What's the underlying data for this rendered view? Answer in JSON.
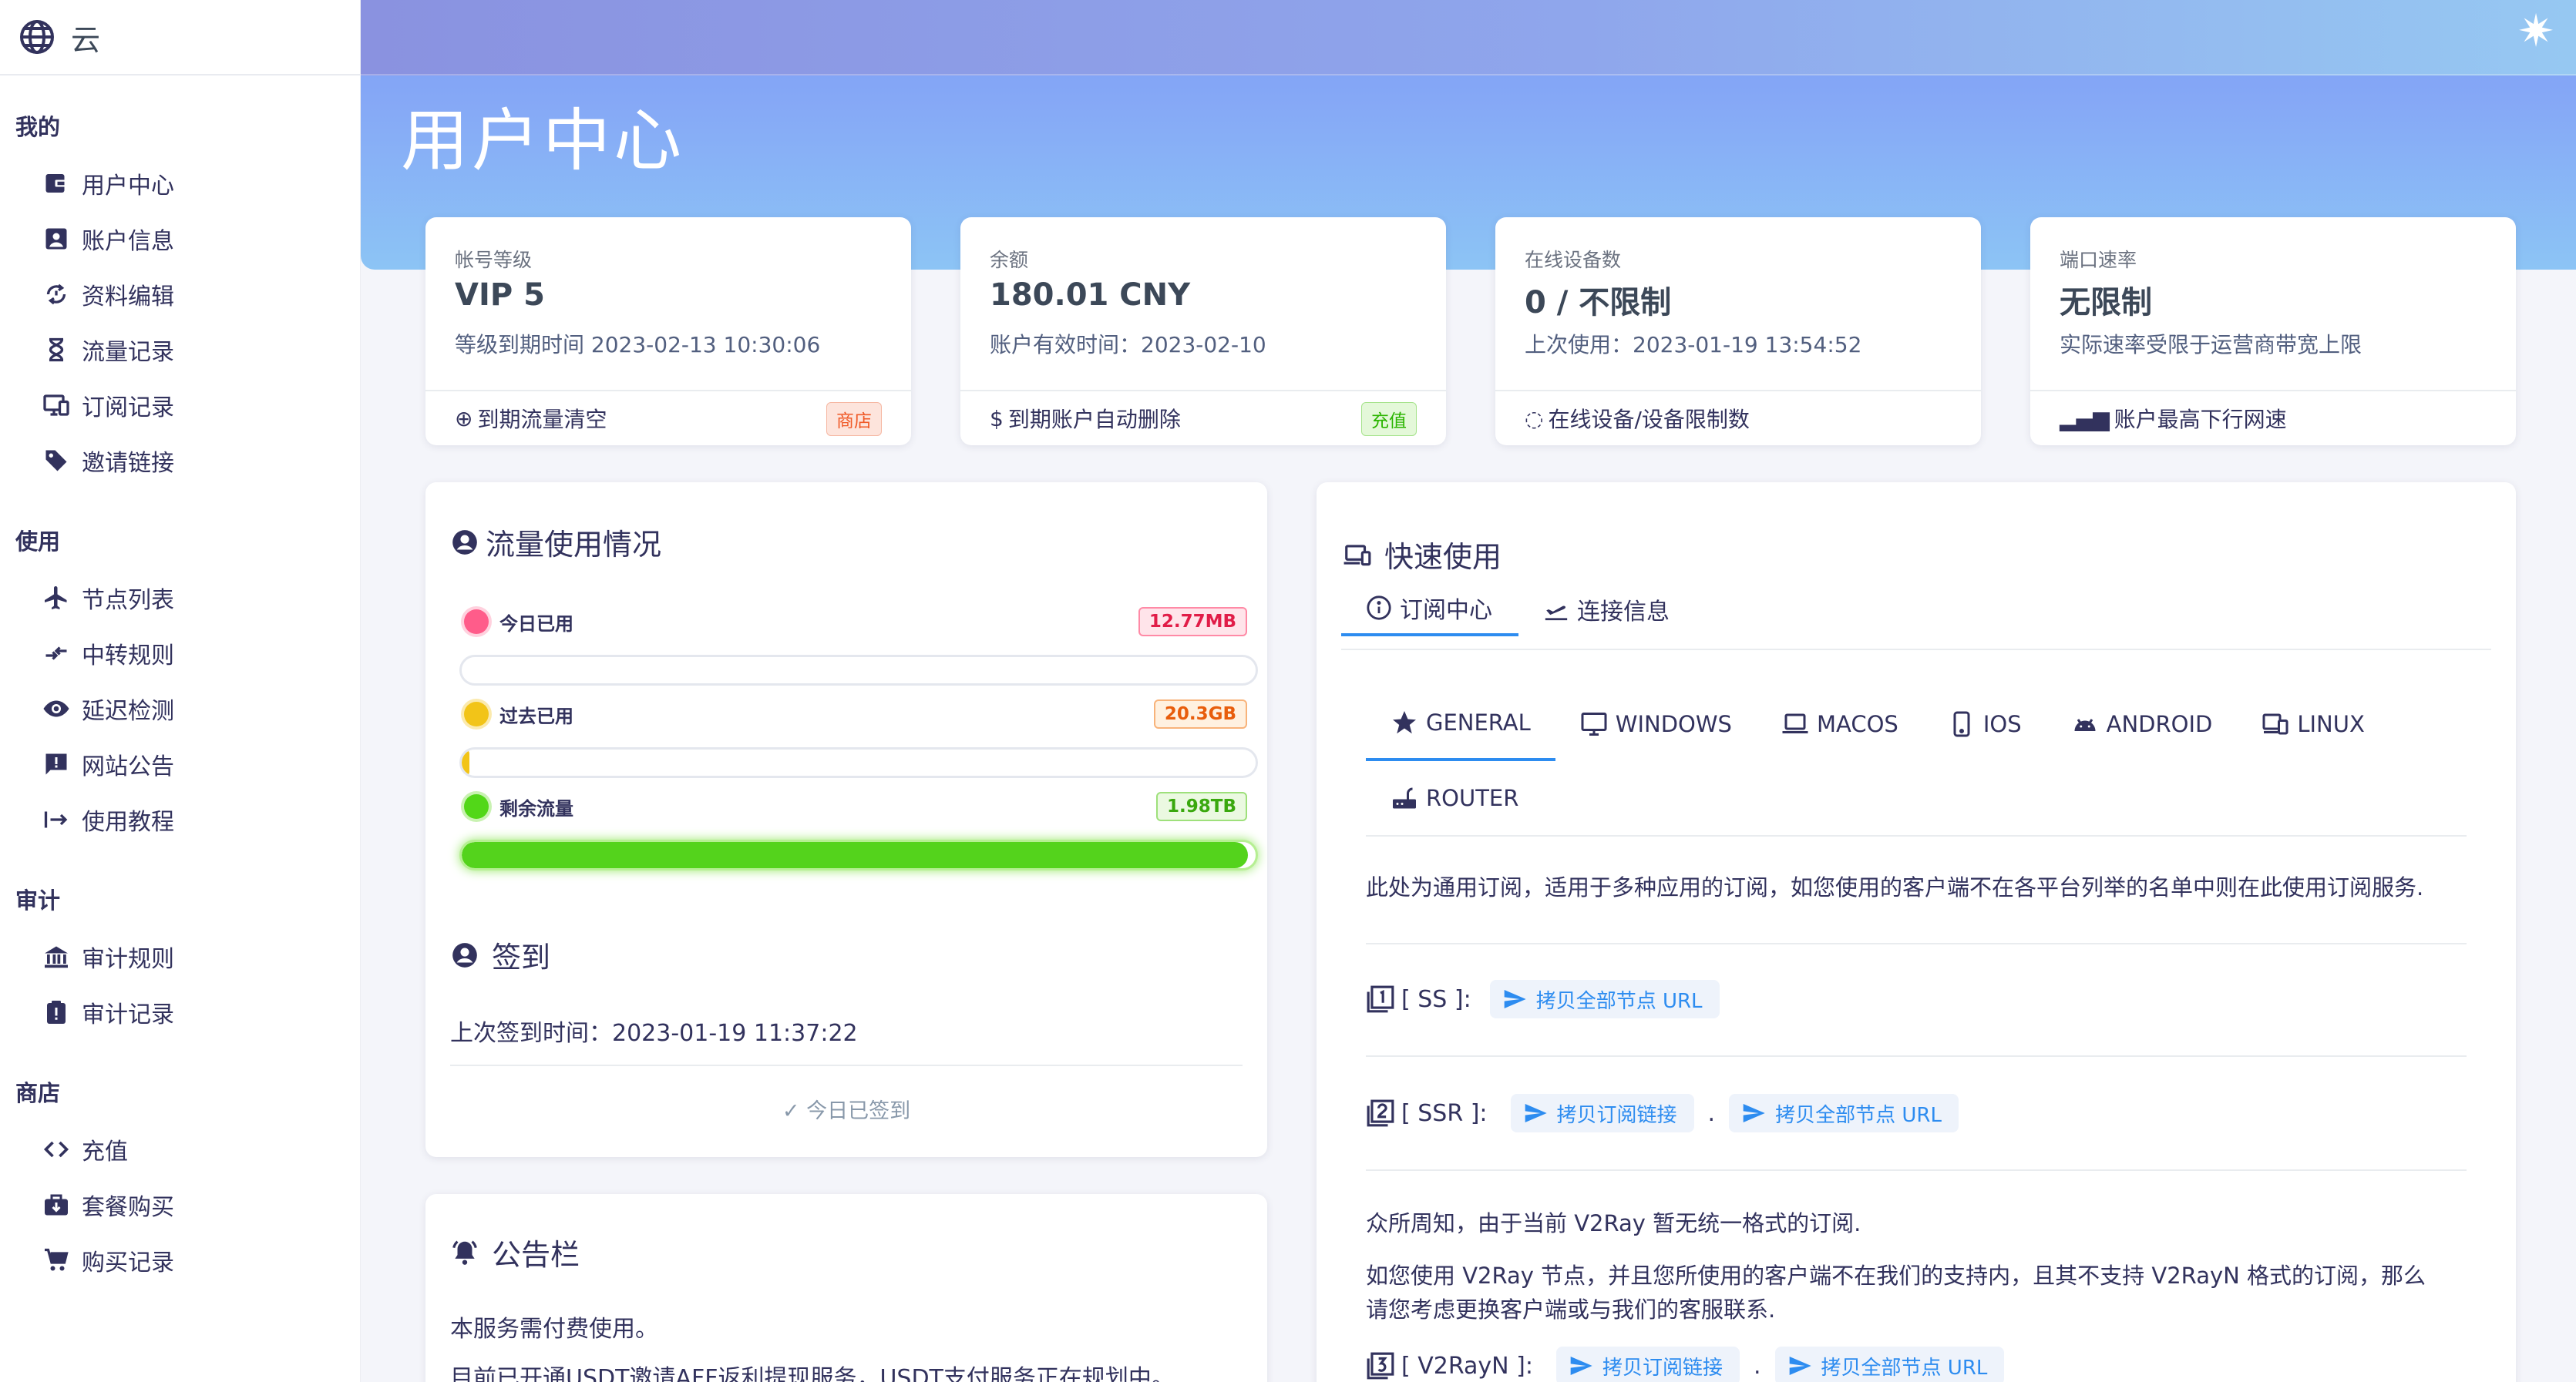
{
  "brand": {
    "name": "云"
  },
  "sidebar": {
    "sections": [
      {
        "title": "我的",
        "items": [
          "用户中心",
          "账户信息",
          "资料编辑",
          "流量记录",
          "订阅记录",
          "邀请链接"
        ]
      },
      {
        "title": "使用",
        "items": [
          "节点列表",
          "中转规则",
          "延迟检测",
          "网站公告",
          "使用教程"
        ]
      },
      {
        "title": "审计",
        "items": [
          "审计规则",
          "审计记录"
        ]
      },
      {
        "title": "商店",
        "items": [
          "充值",
          "套餐购买",
          "购买记录"
        ]
      }
    ]
  },
  "header": {
    "title": "用户中心"
  },
  "stats": [
    {
      "label": "帐号等级",
      "value": "VIP 5",
      "sub": "等级到期时间 2023-02-13 10:30:06",
      "foot": "到期流量清空",
      "badge": "商店"
    },
    {
      "label": "余额",
      "value": "180.01 CNY",
      "sub": "账户有效时间：2023-02-10",
      "foot": "到期账户自动删除",
      "badge": "充值"
    },
    {
      "label": "在线设备数",
      "value": "0 / 不限制",
      "sub": "上次使用：2023-01-19 13:54:52",
      "foot": "在线设备/设备限制数"
    },
    {
      "label": "端口速率",
      "value": "无限制",
      "sub": "实际速率受限于运营商带宽上限",
      "foot": "账户最高下行网速"
    }
  ],
  "traffic": {
    "title": "流量使用情况",
    "rows": [
      {
        "label": "今日已用",
        "value": "12.77MB",
        "fill": 0.0
      },
      {
        "label": "过去已用",
        "value": "20.3GB",
        "fill": 0.01
      },
      {
        "label": "剩余流量",
        "value": "1.98TB",
        "fill": 0.99
      }
    ]
  },
  "checkin": {
    "title": "签到",
    "last": "上次签到时间：2023-01-19 11:37:22",
    "status": "今日已签到"
  },
  "notice": {
    "title": "公告栏",
    "line1": "本服务需付费使用。",
    "line2": "目前已开通USDT邀请AFF返利提现服务，USDT支付服务正在规划中。"
  },
  "quick": {
    "title": "快速使用",
    "tabs": [
      "订阅中心",
      "连接信息"
    ],
    "os_tabs": [
      "GENERAL",
      "WINDOWS",
      "MACOS",
      "IOS",
      "ANDROID",
      "LINUX",
      "ROUTER"
    ],
    "desc": "此处为通用订阅，适用于多种应用的订阅，如您使用的客户端不在各平台列举的名单中则在此使用订阅服务.",
    "ss_label": "[ SS ]:",
    "ssr_label": "[ SSR ]:",
    "v2rayn_label": "[ V2RayN ]:",
    "copy_all": "拷贝全部节点 URL",
    "copy_sub": "拷贝订阅链接",
    "dot": ".",
    "v2_note1": "众所周知，由于当前 V2Ray 暂无统一格式的订阅.",
    "v2_note2": "如您使用 V2Ray 节点，并且您所使用的客户端不在我们的支持内，且其不支持 V2RayN 格式的订阅，那么",
    "v2_note3": "请您考虑更换客户端或与我们的客服联系."
  }
}
